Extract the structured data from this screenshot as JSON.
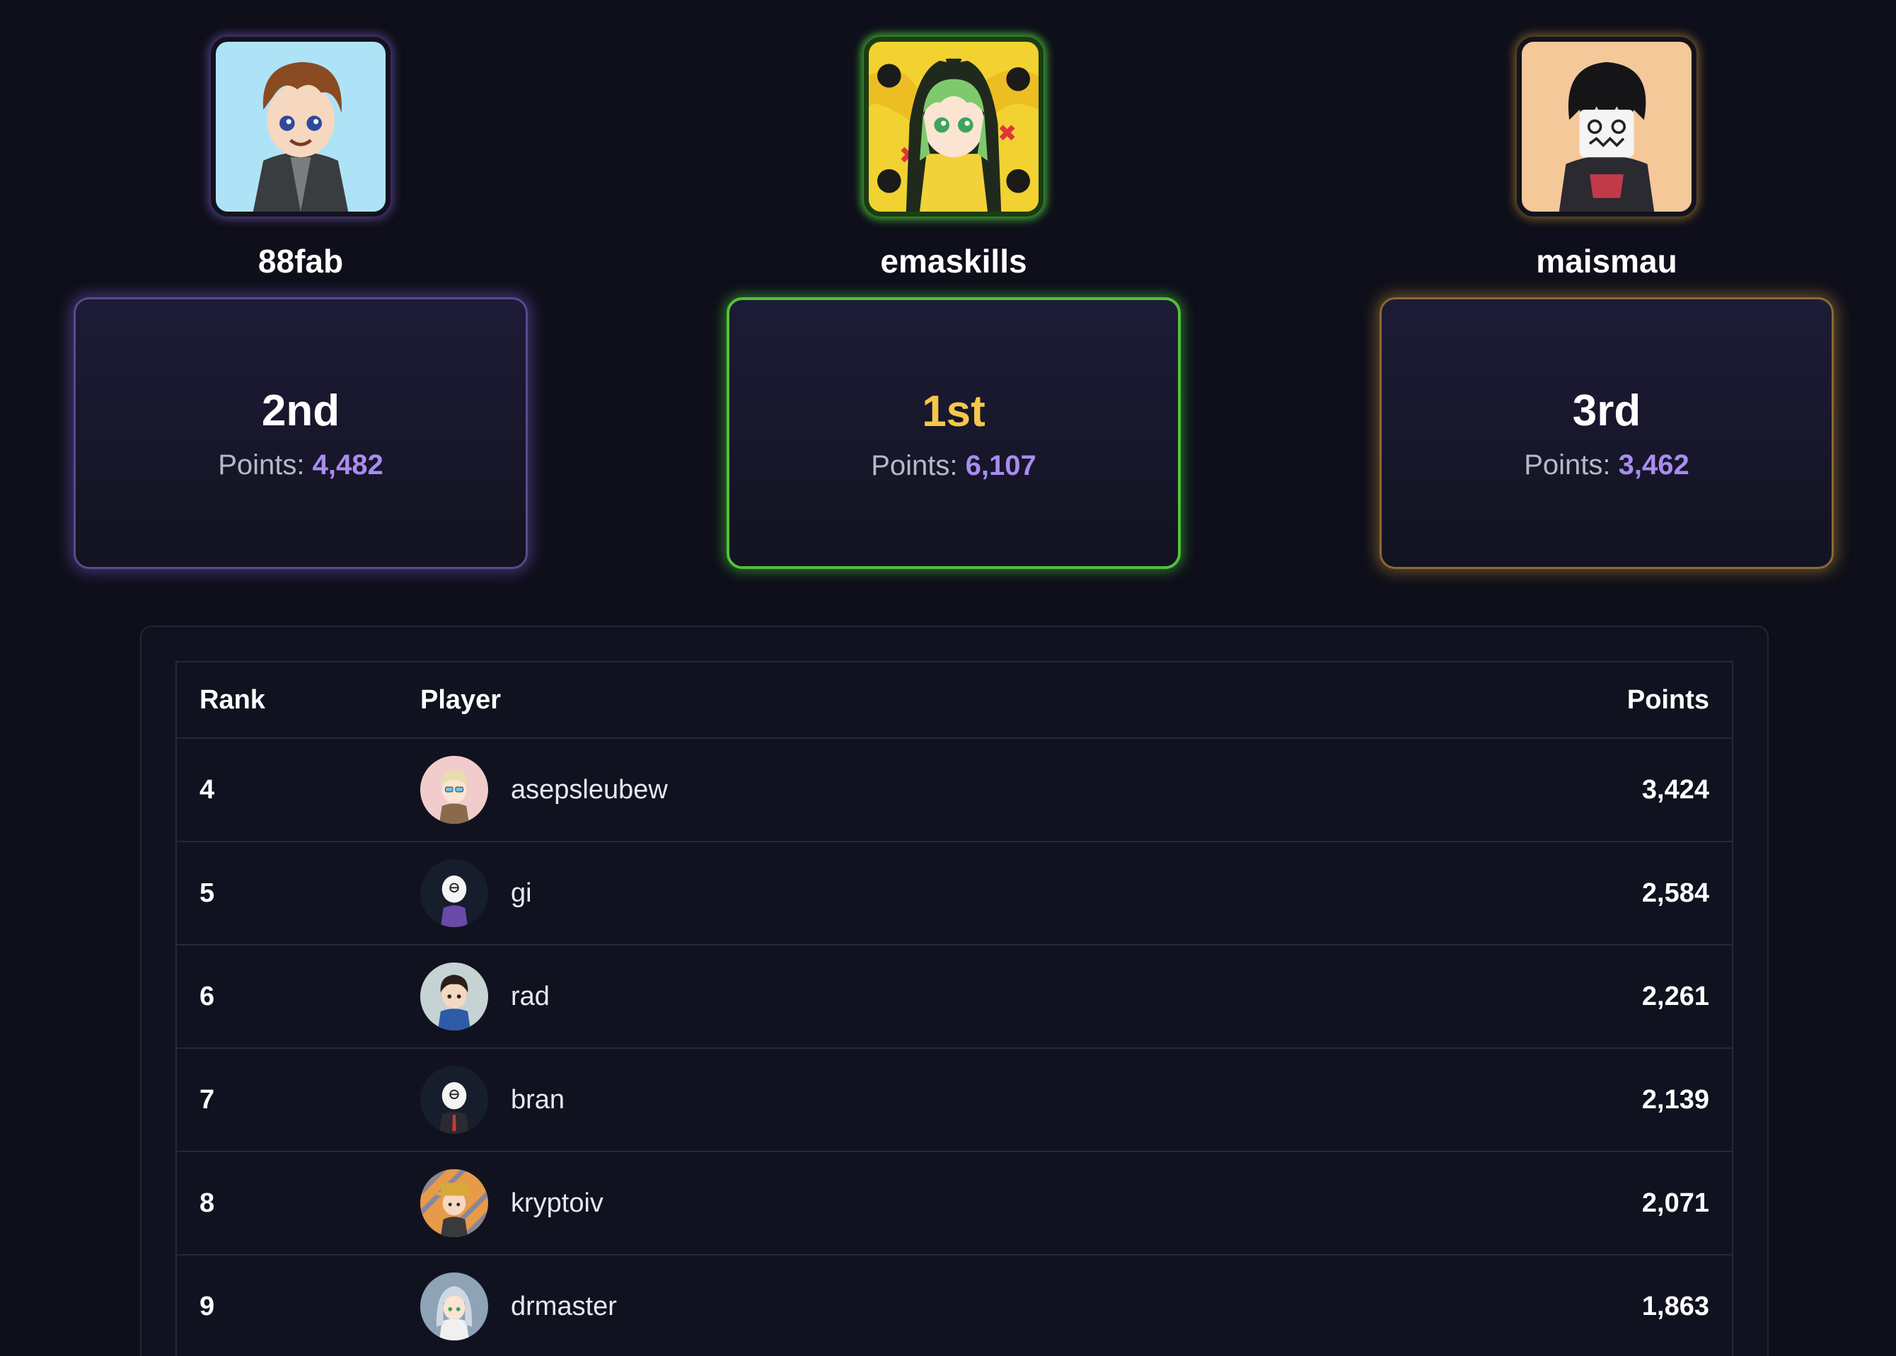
{
  "podium": {
    "first": {
      "name": "emaskills",
      "place": "1st",
      "points_label": "Points: ",
      "points": "6,107",
      "avatar": "green-hood-anime-avatar"
    },
    "second": {
      "name": "88fab",
      "place": "2nd",
      "points_label": "Points: ",
      "points": "4,482",
      "avatar": "brown-hair-boy-avatar"
    },
    "third": {
      "name": "maismau",
      "place": "3rd",
      "points_label": "Points: ",
      "points": "3,462",
      "avatar": "masked-black-hair-avatar"
    }
  },
  "table": {
    "headers": {
      "rank": "Rank",
      "player": "Player",
      "points": "Points"
    },
    "rows": [
      {
        "rank": "4",
        "player": "asepsleubew",
        "points": "3,424",
        "avatar_color": "#e8c4c4"
      },
      {
        "rank": "5",
        "player": "gi",
        "points": "2,584",
        "avatar_color": "#1a2233"
      },
      {
        "rank": "6",
        "player": "rad",
        "points": "2,261",
        "avatar_color": "#c9d6d6"
      },
      {
        "rank": "7",
        "player": "bran",
        "points": "2,139",
        "avatar_color": "#1a2233"
      },
      {
        "rank": "8",
        "player": "kryptoiv",
        "points": "2,071",
        "avatar_color": "#e0a050"
      },
      {
        "rank": "9",
        "player": "drmaster",
        "points": "1,863",
        "avatar_color": "#8aa0b4"
      }
    ]
  },
  "colors": {
    "background": "#0e0f1a",
    "first_accent": "#4fc23a",
    "first_place_text": "#f4c84b",
    "second_accent": "#8c64e6",
    "third_accent": "#dca03c",
    "points_value": "#a98cf0"
  }
}
